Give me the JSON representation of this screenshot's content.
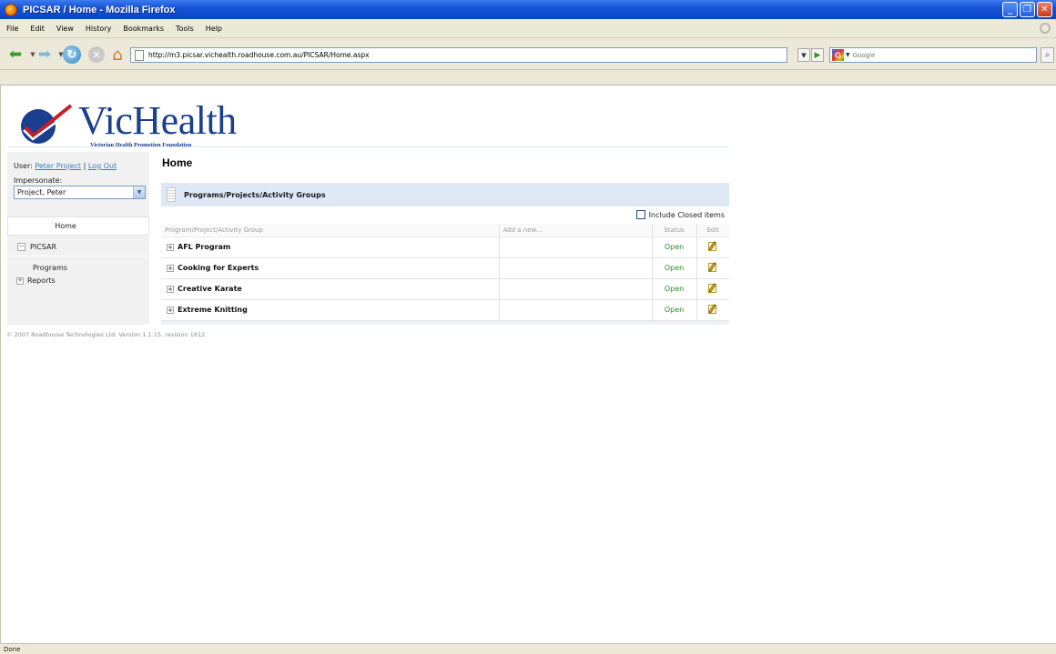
{
  "window": {
    "title": "PICSAR / Home - Mozilla Firefox"
  },
  "menubar": {
    "items": [
      "File",
      "Edit",
      "View",
      "History",
      "Bookmarks",
      "Tools",
      "Help"
    ]
  },
  "navbar": {
    "url": "http://m3.picsar.vichealth.roadhouse.com.au/PICSAR/Home.aspx",
    "search_placeholder": "Google"
  },
  "logo": {
    "wordmark": "VicHealth",
    "tagline": "Victorian Health Promotion Foundation"
  },
  "user": {
    "label": "User:",
    "name": "Peter Project",
    "separator": " | ",
    "logout": "Log Out",
    "impersonate_label": "Impersonate:",
    "impersonate_value": "Project, Peter"
  },
  "leftnav": {
    "home": "Home",
    "picsar": "PICSAR",
    "programs": "Programs",
    "reports": "Reports"
  },
  "main": {
    "title": "Home",
    "section_title": "Programs/Projects/Activity Groups",
    "include_closed": "Include Closed items",
    "columns": {
      "name": "Program/Project/Activity Group",
      "add": "Add a new...",
      "status": "Status",
      "edit": "Edit"
    },
    "rows": [
      {
        "name": "AFL Program",
        "status": "Open"
      },
      {
        "name": "Cooking for Experts",
        "status": "Open"
      },
      {
        "name": "Creative Karate",
        "status": "Open"
      },
      {
        "name": "Extreme Knitting",
        "status": "Open"
      }
    ]
  },
  "footer": {
    "copyright": "© 2007 Roadhouse Technologies Ltd.   Version 1.1.15, revision 1612."
  },
  "statusbar": {
    "text": "Done"
  },
  "colors": {
    "titlebar": "#1553d6",
    "brand": "#1b3f8f",
    "link": "#3b7ec0",
    "open_status": "#2a8a2a",
    "section_bg": "#dfe8f5"
  }
}
